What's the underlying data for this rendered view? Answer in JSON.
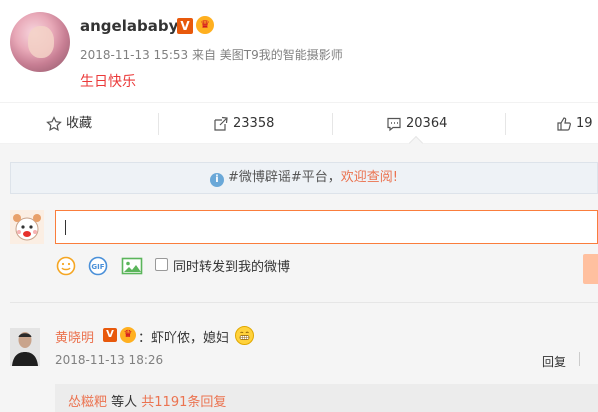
{
  "post": {
    "username": "angelababy",
    "verified_badge": "V",
    "meta": "2018-11-13 15:53 来自 美图T9我的智能摄影师",
    "text": "生日快乐"
  },
  "actions": {
    "favorite_label": "收藏",
    "repost_count": "23358",
    "comment_count": "20364",
    "like_count": "19"
  },
  "notice": {
    "hashtag": "#微博辟谣#平台，",
    "link_text": "欢迎查阅!"
  },
  "composer": {
    "repost_checkbox_label": "同时转发到我的微博"
  },
  "comment": {
    "author": "黄晓明",
    "verified_badge": "V",
    "text": "：虾吖侬，媳妇",
    "time": "2018-11-13 18:26",
    "reply_label": "回复",
    "sub_replies": {
      "first_user": "怂糍粑",
      "middle": " 等人 ",
      "total_link": "共1191条回复"
    }
  },
  "colors": {
    "accent": "#eb7350",
    "input_border": "#fa7d3c",
    "post_text": "#eb3a3a",
    "verified": "#e8590c"
  }
}
